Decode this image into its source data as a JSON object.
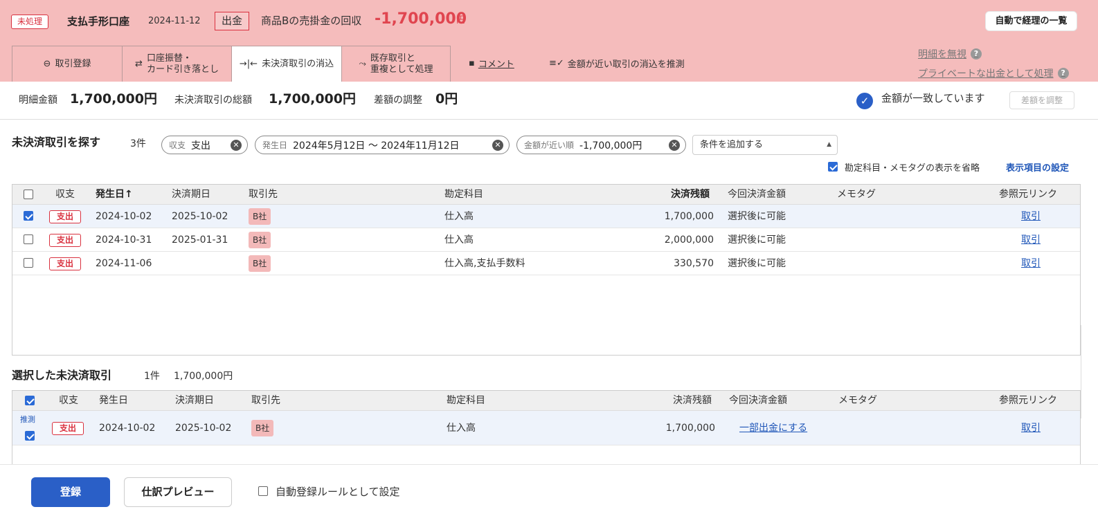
{
  "header": {
    "status_badge": "未処理",
    "account": "支払手形口座",
    "date": "2024-11-12",
    "direction": "出金",
    "description": "商品Bの売掛金の回収",
    "amount": "-1,700,000",
    "currency": "円",
    "auto_list_button": "自動で経理の一覧"
  },
  "tabs": [
    {
      "label": "取引登録",
      "icon": "minus-circle-icon"
    },
    {
      "label_line1": "口座振替・",
      "label_line2": "カード引き落とし",
      "icon": "swap-arrows-icon"
    },
    {
      "label": "未決済取引の消込",
      "icon": "merge-icon"
    },
    {
      "label_line1": "既存取引と",
      "label_line2": "重複として処理",
      "icon": "branch-merge-icon"
    }
  ],
  "links": {
    "comment": "コメント",
    "guess": "金額が近い取引の消込を推測",
    "ignore": "明細を無視",
    "private": "プライベートな出金として処理"
  },
  "summary": {
    "detail_label": "明細金額",
    "detail_value": "1,700,000円",
    "unsettled_label": "未決済取引の総額",
    "unsettled_value": "1,700,000円",
    "diff_label": "差額の調整",
    "diff_value": "0円",
    "match_text": "金額が一致しています",
    "adjust_button": "差額を調整"
  },
  "search": {
    "title": "未決済取引を探す",
    "count": "3件",
    "chips": [
      {
        "key": "収支",
        "value": "支出"
      },
      {
        "key": "発生日",
        "value": "2024年5月12日 〜 2024年11月12日"
      },
      {
        "key": "金額が近い順",
        "value": "-1,700,000円"
      }
    ],
    "add_condition": "条件を追加する",
    "omit_label": "勘定科目・メモタグの表示を省略",
    "display_settings": "表示項目の設定"
  },
  "table": {
    "headers": {
      "type": "収支",
      "date": "発生日",
      "sort_arrow": "↑",
      "due": "決済期日",
      "partner": "取引先",
      "account": "勘定科目",
      "balance": "決済残額",
      "this_amount": "今回決済金額",
      "memo": "メモタグ",
      "ref": "参照元リンク"
    },
    "rows": [
      {
        "checked": true,
        "type": "支出",
        "date": "2024-10-02",
        "due": "2025-10-02",
        "partner": "B社",
        "account": "仕入高",
        "balance": "1,700,000",
        "this_amount": "選択後に可能",
        "ref": "取引"
      },
      {
        "checked": false,
        "type": "支出",
        "date": "2024-10-31",
        "due": "2025-01-31",
        "partner": "B社",
        "account": "仕入高",
        "balance": "2,000,000",
        "this_amount": "選択後に可能",
        "ref": "取引"
      },
      {
        "checked": false,
        "type": "支出",
        "date": "2024-11-06",
        "due": "",
        "partner": "B社",
        "account": "仕入高,支払手数料",
        "balance": "330,570",
        "this_amount": "選択後に可能",
        "ref": "取引"
      }
    ]
  },
  "selected": {
    "title": "選択した未決済取引",
    "count": "1件",
    "total": "1,700,000円",
    "guess_label": "推測",
    "row": {
      "type": "支出",
      "date": "2024-10-02",
      "due": "2025-10-02",
      "partner": "B社",
      "account": "仕入高",
      "balance": "1,700,000",
      "this_amount": "一部出金にする",
      "ref": "取引"
    }
  },
  "footer": {
    "register": "登録",
    "preview": "仕訳プレビュー",
    "auto_rule": "自動登録ルールとして設定"
  },
  "colors": {
    "header_bg": "#f5bcbc",
    "accent_red": "#e0454f",
    "primary_blue": "#2a5fc7",
    "link_blue": "#1f56b8"
  }
}
